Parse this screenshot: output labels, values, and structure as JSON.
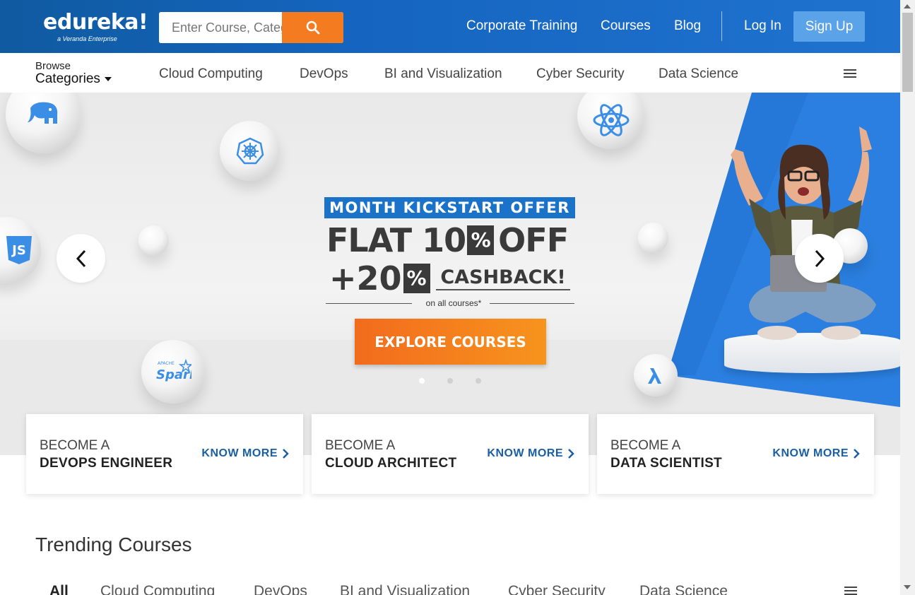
{
  "header": {
    "logo_text": "edureka!",
    "logo_sub": "a Veranda Enterprise",
    "search_placeholder": "Enter Course, Category or keyword",
    "nav": [
      "Corporate Training",
      "Courses",
      "Blog"
    ],
    "login": "Log In",
    "signup": "Sign Up"
  },
  "catbar": {
    "browse": "Browse",
    "categories": "Categories",
    "links": [
      "Cloud Computing",
      "DevOps",
      "BI and Visualization",
      "Cyber Security",
      "Data Science"
    ]
  },
  "hero": {
    "offer_title": "MONTH KICKSTART OFFER",
    "flat": "FLAT 10",
    "off": "OFF",
    "plus": "+20",
    "pct": "%",
    "cashback": "CASHBACK!",
    "on_all": "on all courses*",
    "cta": "EXPLORE COURSES",
    "active_slide": 1,
    "slides": 3
  },
  "cards": [
    {
      "line1": "BECOME A",
      "line2": "DEVOPS ENGINEER",
      "cta": "KNOW MORE"
    },
    {
      "line1": "BECOME A",
      "line2": "CLOUD ARCHITECT",
      "cta": "KNOW MORE"
    },
    {
      "line1": "BECOME A",
      "line2": "DATA SCIENTIST",
      "cta": "KNOW MORE"
    }
  ],
  "trending": {
    "title": "Trending Courses",
    "tabs": [
      "All",
      "Cloud Computing",
      "DevOps",
      "BI and Visualization",
      "Cyber Security",
      "Data Science"
    ]
  },
  "ball_labels": {
    "js": "JS",
    "spark": "Spark",
    "apache": "APACHE"
  },
  "colors": {
    "brand": "#1565c0",
    "accent": "#f47b20",
    "link": "#1a5fa3"
  }
}
